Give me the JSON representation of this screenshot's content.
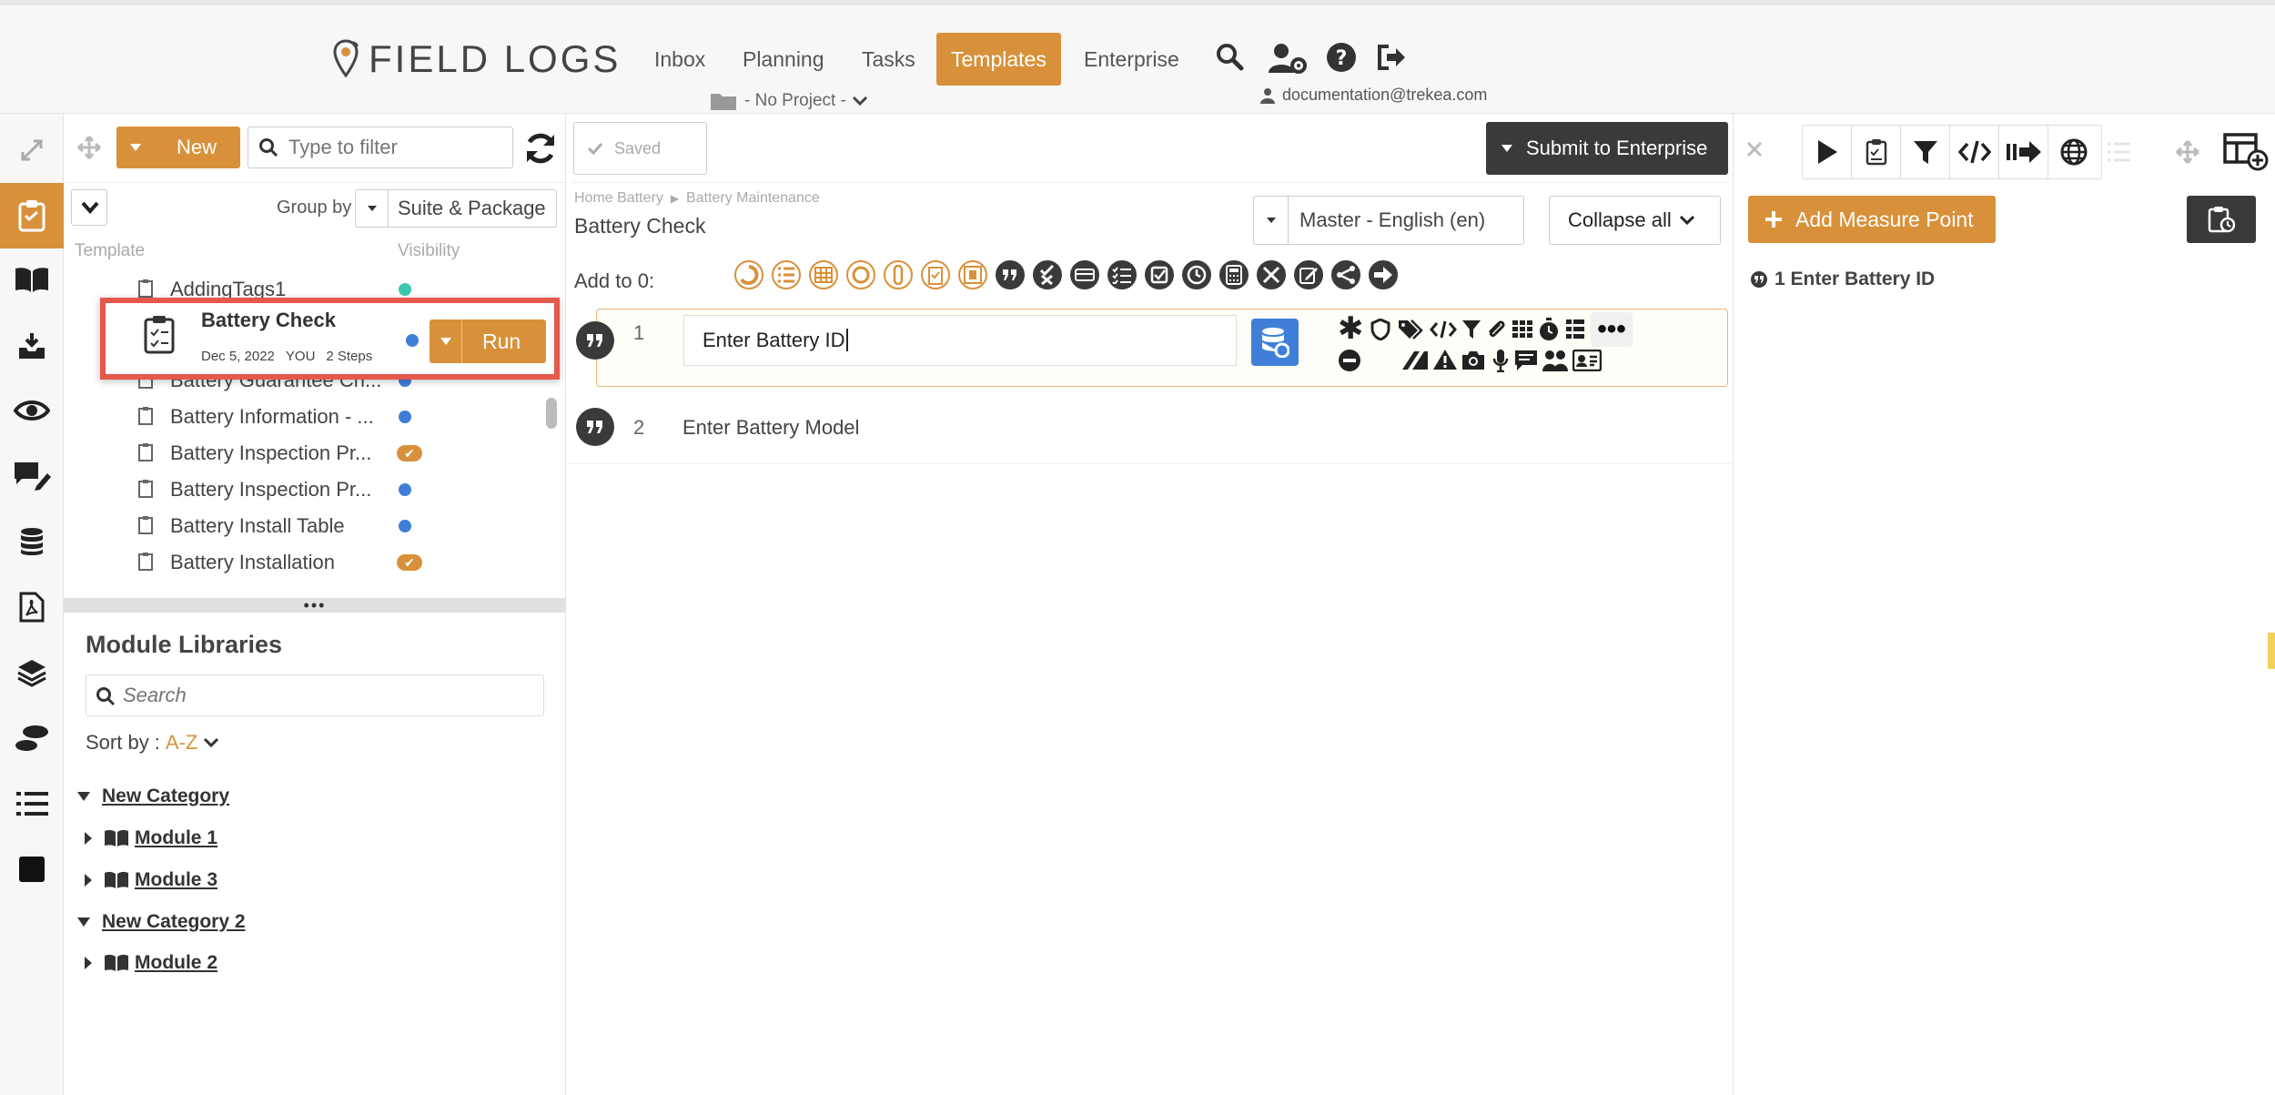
{
  "brand": {
    "name": "FIELD LOGS"
  },
  "nav": {
    "inbox": "Inbox",
    "planning": "Planning",
    "tasks": "Tasks",
    "templates": "Templates",
    "enterprise": "Enterprise"
  },
  "project": {
    "label": "- No Project -"
  },
  "user": {
    "email": "documentation@trekea.com"
  },
  "templates_panel": {
    "new_label": "New",
    "filter_placeholder": "Type to filter",
    "group_by_label": "Group by",
    "group_by_value": "Suite & Package",
    "col_template": "Template",
    "col_visibility": "Visibility",
    "rows": [
      {
        "name": "AddingTags1"
      },
      {
        "name": "Battery Check",
        "date": "Dec 5, 2022",
        "owner": "YOU",
        "steps": "2 Steps",
        "run": "Run"
      },
      {
        "name": "Battery Guarantee Ch..."
      },
      {
        "name": "Battery Information - ..."
      },
      {
        "name": "Battery Inspection Pr..."
      },
      {
        "name": "Battery Inspection Pr..."
      },
      {
        "name": "Battery Install Table"
      },
      {
        "name": "Battery Installation"
      }
    ]
  },
  "modules": {
    "title": "Module Libraries",
    "search_placeholder": "Search",
    "sort_label": "Sort by :",
    "sort_value": "A-Z",
    "categories": [
      {
        "name": "New Category",
        "modules": [
          "Module 1",
          "Module 3"
        ]
      },
      {
        "name": "New Category 2",
        "modules": [
          "Module 2"
        ]
      }
    ]
  },
  "editor": {
    "saved_label": "Saved",
    "submit_label": "Submit to Enterprise",
    "breadcrumb_root": "Home Battery",
    "breadcrumb_child": "Battery Maintenance",
    "title": "Battery Check",
    "language": "Master - English (en)",
    "collapse_label": "Collapse all",
    "add_to_label": "Add to 0:",
    "steps": [
      {
        "num": "1",
        "text": "Enter Battery ID"
      },
      {
        "num": "2",
        "text": "Enter Battery Model"
      }
    ]
  },
  "right_panel": {
    "add_measure_label": "Add Measure Point",
    "measure_item": "1 Enter Battery ID"
  },
  "colors": {
    "accent": "#d8913a",
    "dark": "#3a3a3a",
    "blue": "#3f7fd9",
    "teal": "#3ec8b0",
    "highlight": "#e5584a"
  }
}
